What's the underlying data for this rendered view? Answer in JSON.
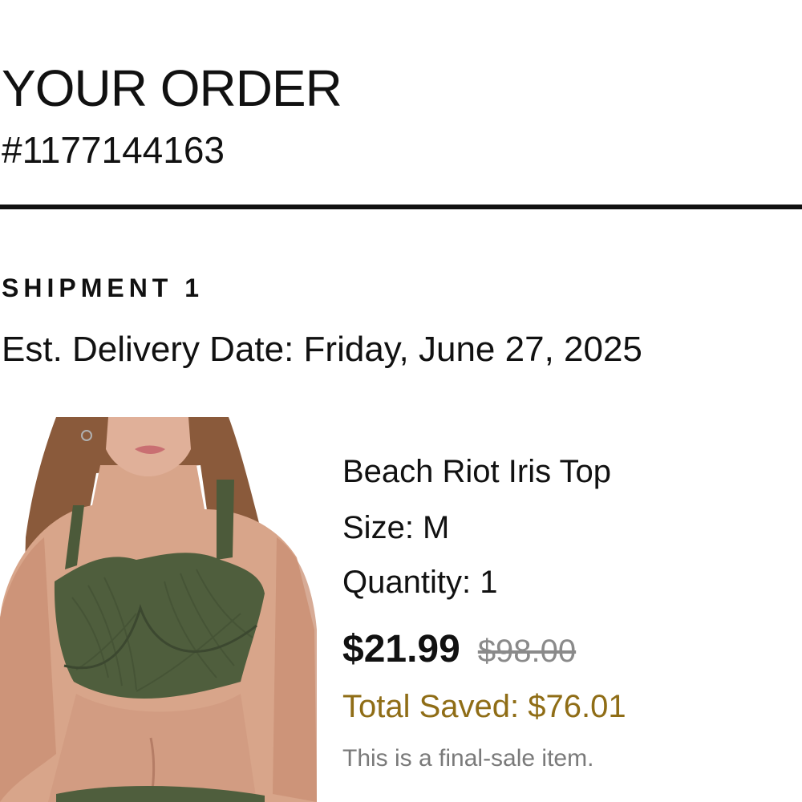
{
  "order": {
    "title": "YOUR ORDER",
    "number": "#1177144163"
  },
  "shipment": {
    "label": "SHIPMENT 1",
    "delivery": "Est. Delivery Date: Friday, June 27, 2025"
  },
  "item": {
    "image_icon": "product-photo",
    "name": "Beach Riot Iris Top",
    "size": "Size: M",
    "quantity": "Quantity: 1",
    "sale_price": "$21.99",
    "original_price": "$98.00",
    "saved": "Total Saved: $76.01",
    "note": "This is a final-sale item."
  },
  "colors": {
    "text": "#111111",
    "saved": "#8f6d16",
    "muted": "#7a7a7a",
    "strikethrough": "#8a8a8a"
  }
}
